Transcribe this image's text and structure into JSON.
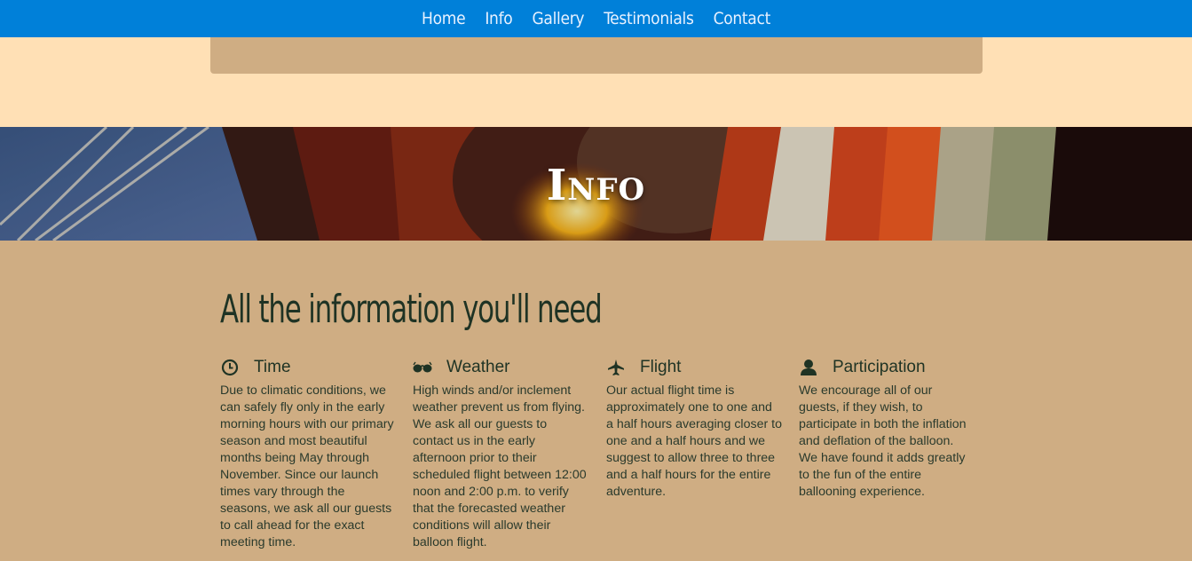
{
  "nav": {
    "items": [
      {
        "label": "Home"
      },
      {
        "label": "Info"
      },
      {
        "label": "Gallery"
      },
      {
        "label": "Testimonials"
      },
      {
        "label": "Contact"
      }
    ]
  },
  "hero": {
    "title": "Info"
  },
  "info": {
    "heading": "All the information you'll need",
    "columns": [
      {
        "icon": "clock-icon",
        "title": "Time",
        "text": "Due to climatic conditions, we can safely fly only in the early morning hours with our primary season and most beautiful months being May through November. Since our launch times vary through the seasons, we ask all our guests to call ahead for the exact meeting time."
      },
      {
        "icon": "sunglasses-icon",
        "title": "Weather",
        "text": "High winds and/or inclement weather prevent us from flying. We ask all our guests to contact us in the early afternoon prior to their scheduled flight between 12:00 noon and 2:00 p.m. to verify that the forecasted weather conditions will allow their balloon flight."
      },
      {
        "icon": "plane-icon",
        "title": "Flight",
        "text": "Our actual flight time is approximately one to one and a half hours averaging closer to one and a half hours and we suggest to allow three to three and a half hours for the entire adventure."
      },
      {
        "icon": "user-icon",
        "title": "Participation",
        "text": "We encourage all of our guests, if they wish, to participate in both the inflation and deflation of the balloon. We have found it adds greatly to the fun of the entire ballooning experience."
      }
    ]
  },
  "colors": {
    "navbar": "#0080d9",
    "page_background": "#ffe0b5",
    "section_background": "#cfad83",
    "text_dark_green": "#1f3324"
  }
}
